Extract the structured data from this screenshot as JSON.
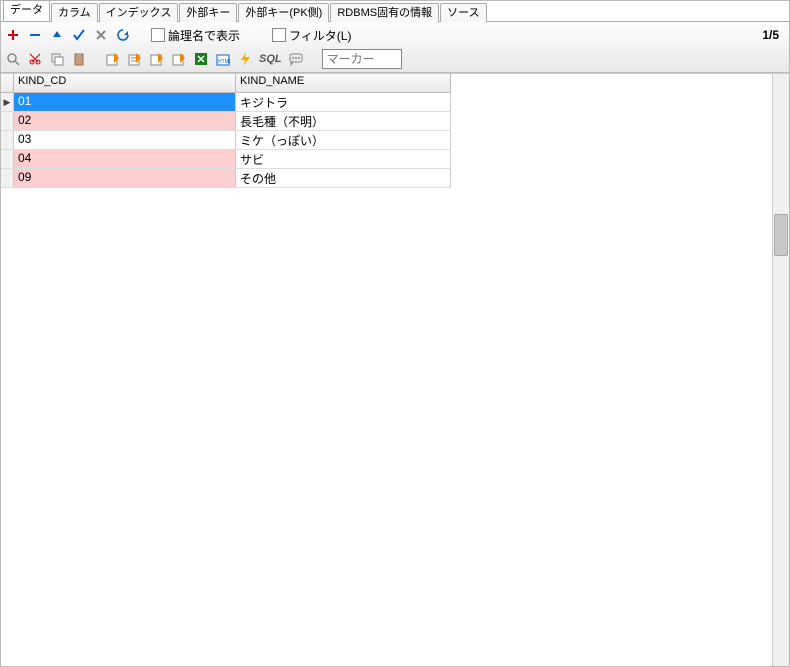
{
  "tabs": {
    "items": [
      {
        "label": "データ",
        "active": true
      },
      {
        "label": "カラム"
      },
      {
        "label": "インデックス"
      },
      {
        "label": "外部キー"
      },
      {
        "label": "外部キー(PK側)"
      },
      {
        "label": "RDBMS固有の情報"
      },
      {
        "label": "ソース"
      }
    ]
  },
  "toolbar1": {
    "logical_name_label": "論理名で表示",
    "filter_label": "フィルタ(L)",
    "paging": "1/5"
  },
  "toolbar2": {
    "marker_placeholder": "マーカー",
    "sql_label": "SQL"
  },
  "grid": {
    "col1": "KIND_CD",
    "col2": "KIND_NAME",
    "rows": [
      {
        "cd": "01",
        "name": "キジトラ",
        "selected": true
      },
      {
        "cd": "02",
        "name": "長毛種（不明）",
        "pink": true
      },
      {
        "cd": "03",
        "name": "ミケ（っぽい）"
      },
      {
        "cd": "04",
        "name": "サビ",
        "pink": true
      },
      {
        "cd": "09",
        "name": "その他",
        "pink": true
      }
    ]
  }
}
